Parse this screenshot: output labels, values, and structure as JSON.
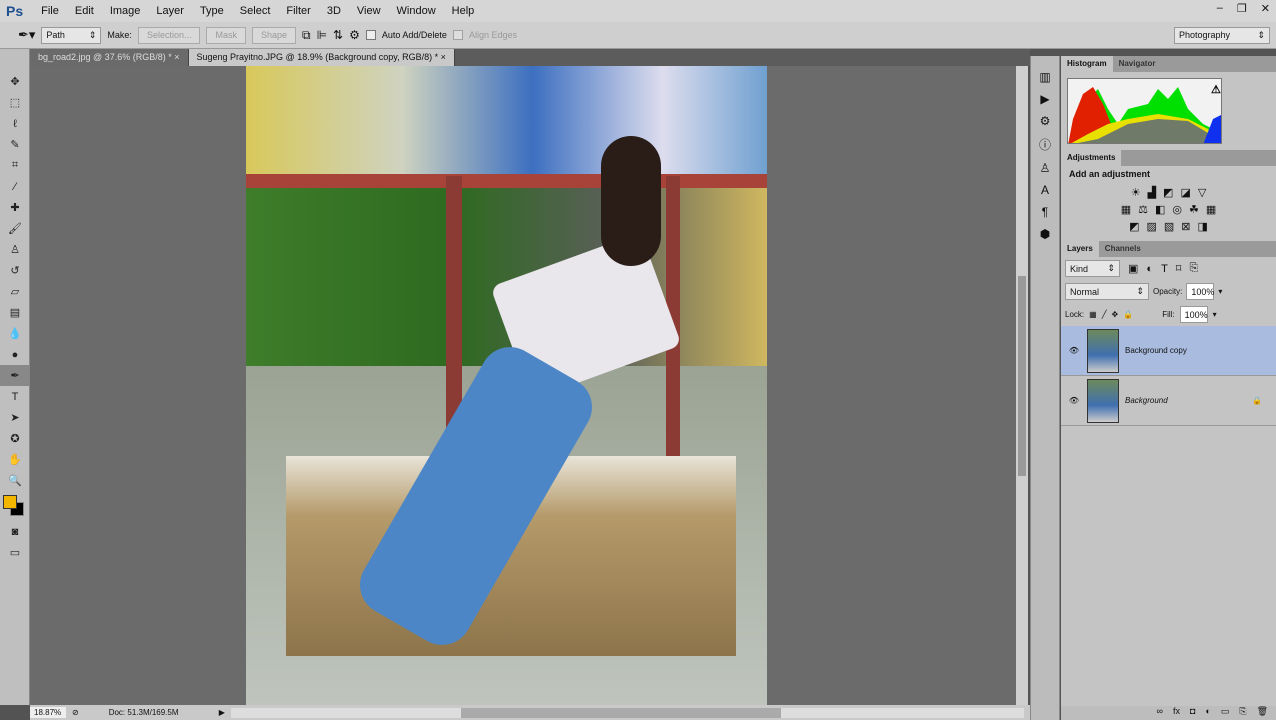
{
  "app": {
    "logo": "Ps",
    "menu": [
      "File",
      "Edit",
      "Image",
      "Layer",
      "Type",
      "Select",
      "Filter",
      "3D",
      "View",
      "Window",
      "Help"
    ],
    "window_buttons": [
      "–",
      "❐",
      "✕"
    ]
  },
  "options": {
    "mode": "Path",
    "make_label": "Make:",
    "selection": "Selection...",
    "mask": "Mask",
    "shape": "Shape",
    "auto_add_delete": "Auto Add/Delete",
    "align_edges": "Align Edges",
    "workspace": "Photography"
  },
  "tabs": [
    {
      "label": "bg_road2.jpg @ 37.6% (RGB/8) *",
      "active": false
    },
    {
      "label": "Sugeng Prayitno.JPG @ 18.9% (Background copy, RGB/8) *",
      "active": true
    }
  ],
  "status": {
    "zoom": "18.87%",
    "doc": "Doc: 51.3M/169.5M"
  },
  "panels": {
    "histogram_tabs": [
      "Histogram",
      "Navigator"
    ],
    "adjustments": {
      "tab": "Adjustments",
      "title": "Add an adjustment"
    },
    "layers": {
      "tabs": [
        "Layers",
        "Channels"
      ],
      "filter": "Kind",
      "blend": "Normal",
      "opacity_label": "Opacity:",
      "opacity": "100%",
      "lock_label": "Lock:",
      "fill_label": "Fill:",
      "fill": "100%",
      "items": [
        {
          "name": "Background copy",
          "selected": true,
          "locked": false
        },
        {
          "name": "Background",
          "selected": false,
          "locked": true
        }
      ]
    }
  },
  "colors": {
    "foreground": "#f2b600",
    "background": "#000000",
    "selection": "#a9bcdf"
  }
}
